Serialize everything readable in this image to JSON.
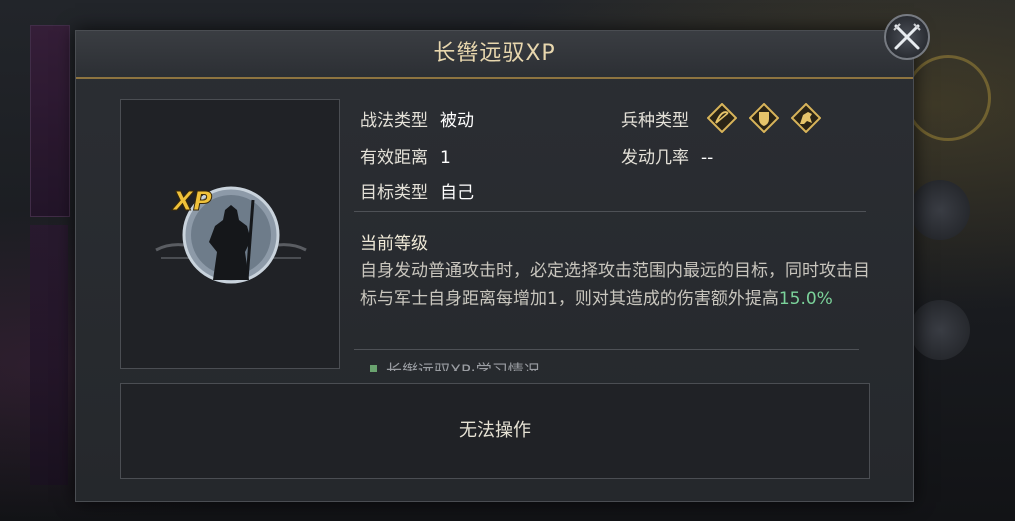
{
  "dialog": {
    "title": "长辔远驭XP",
    "close_icon": "crossed-swords-close-icon"
  },
  "portrait": {
    "icon": "xp-warrior-portrait-icon",
    "badge_text": "XP"
  },
  "attributes": {
    "tactic_type_label": "战法类型",
    "tactic_type_value": "被动",
    "range_label": "有效距离",
    "range_value": "1",
    "target_label": "目标类型",
    "target_value": "自己",
    "troop_label": "兵种类型",
    "troop_icons": [
      "bow-cavalry-icon",
      "shield-infantry-icon",
      "horse-cavalry-icon"
    ],
    "trigger_label": "发动几率",
    "trigger_value": "--"
  },
  "level": {
    "title": "当前等级",
    "desc_part1": "自身发动普通攻击时，必定选择攻击范围内最远的目标，同时攻击目标与军士自身距离每增加1，则对其造成的伤害额外提高",
    "desc_highlight": "15.0%"
  },
  "learning_entry": "长辔远驭XP·学习情况",
  "action": {
    "label": "无法操作"
  },
  "colors": {
    "title_gold": "#e8d7ae",
    "accent_gold": "#8e7440",
    "highlight_green": "#7bd29a",
    "panel_bg": "#25282c"
  }
}
